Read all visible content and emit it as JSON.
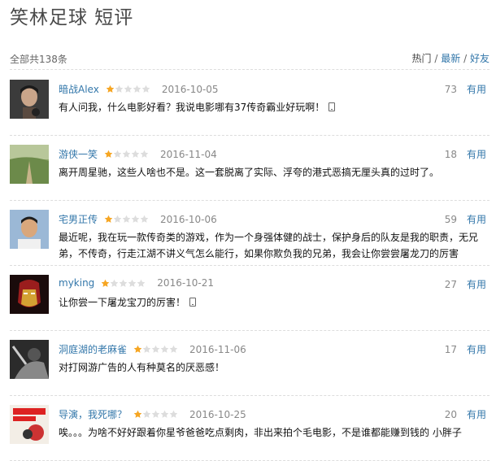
{
  "page": {
    "title": "笑林足球 短评"
  },
  "summary": {
    "total": "全部共138条"
  },
  "sort": {
    "hot": "热门",
    "divider": "/",
    "latest": "最新",
    "friends": "好友"
  },
  "colors": {
    "link": "#3377aa",
    "star_filled": "#f6a623",
    "star_empty": "#dddddd"
  },
  "reviews": [
    {
      "author": "暗战Alex",
      "rating": 1,
      "date": "2016-10-05",
      "votes": "73",
      "useful_label": "有用",
      "text": "有人问我，什么电影好看？我说电影哪有37传奇霸业好玩啊！",
      "mobile": true,
      "avatar_icon": "man-portrait-avatar"
    },
    {
      "author": "游侠一笑",
      "rating": 1,
      "date": "2016-11-04",
      "votes": "18",
      "useful_label": "有用",
      "text": "离开周星驰，这些人啥也不是。这一套脱离了实际、浮夸的港式恶搞无厘头真的过时了。",
      "mobile": false,
      "avatar_icon": "landscape-avatar"
    },
    {
      "author": "宅男正传",
      "rating": 1,
      "date": "2016-10-06",
      "votes": "59",
      "useful_label": "有用",
      "text": "最近呢，我在玩一款传奇类的游戏，作为一个身强体健的战士，保护身后的队友是我的职责，无兄弟，不传奇，行走江湖不讲义气怎么能行，如果你欺负我的兄弟，我会让你尝尝屠龙刀的厉害",
      "mobile": false,
      "avatar_icon": "young-man-avatar"
    },
    {
      "author": "myking",
      "rating": 1,
      "date": "2016-10-21",
      "votes": "27",
      "useful_label": "有用",
      "text": "让你尝一下屠龙宝刀的厉害！",
      "mobile": true,
      "avatar_icon": "iron-mask-avatar"
    },
    {
      "author": "洞庭湖的老麻雀",
      "rating": 1,
      "date": "2016-11-06",
      "votes": "17",
      "useful_label": "有用",
      "text": "对打网游广告的人有种莫名的厌恶感！",
      "mobile": false,
      "avatar_icon": "dark-portrait-avatar"
    },
    {
      "author": "导演，我死哪？",
      "rating": 1,
      "date": "2016-10-25",
      "votes": "20",
      "useful_label": "有用",
      "text": "唉。。。为啥不好好跟着你星爷爸爸吃点剩肉，非出来拍个毛电影，不是谁都能赚到钱的 小胖子",
      "mobile": false,
      "avatar_icon": "red-riding-hood-avatar"
    }
  ]
}
